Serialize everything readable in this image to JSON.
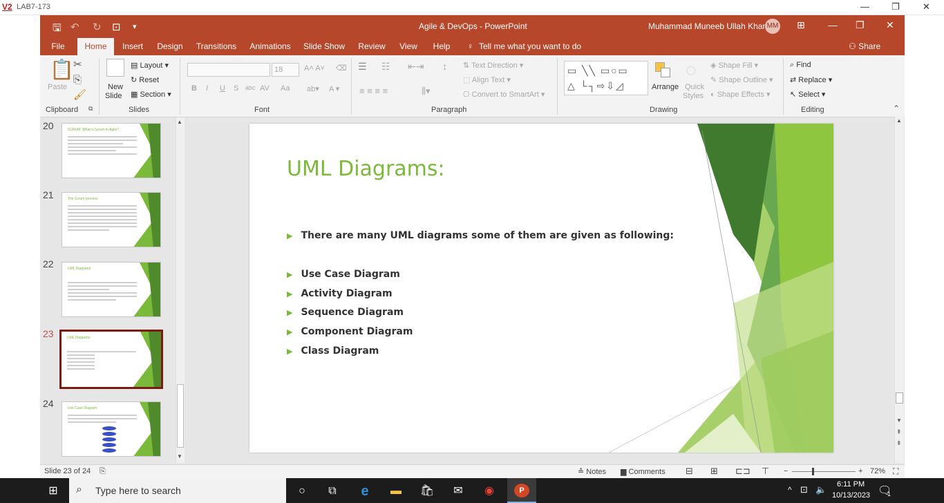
{
  "outer": {
    "logo": "V2",
    "title": "LAB7-173",
    "controls": [
      "—",
      "❐",
      "✕"
    ]
  },
  "titlebar": {
    "doc_title": "Agile & DevOps  -  PowerPoint",
    "user": "Muhammad Muneeb Ullah Khan",
    "avatar": "MM"
  },
  "tabs": [
    "File",
    "Home",
    "Insert",
    "Design",
    "Transitions",
    "Animations",
    "Slide Show",
    "Review",
    "View",
    "Help"
  ],
  "active_tab": "Home",
  "tell_me": "Tell me what you want to do",
  "share": "Share",
  "ribbon": {
    "clipboard": {
      "paste": "Paste",
      "label": "Clipboard"
    },
    "slides": {
      "new_slide": "New",
      "new_slide2": "Slide",
      "layout": "Layout",
      "reset": "Reset",
      "section": "Section",
      "label": "Slides"
    },
    "font": {
      "size": "18",
      "bold": "B",
      "italic": "I",
      "underline": "U",
      "shadow": "S",
      "strike": "abc",
      "spacing": "AV",
      "case": "Aa",
      "label": "Font"
    },
    "paragraph": {
      "text_direction": "Text Direction",
      "align_text": "Align Text",
      "convert": "Convert to SmartArt",
      "label": "Paragraph"
    },
    "drawing": {
      "arrange": "Arrange",
      "quick": "Quick",
      "styles": "Styles",
      "shape_fill": "Shape Fill",
      "shape_outline": "Shape Outline",
      "shape_effects": "Shape Effects",
      "label": "Drawing"
    },
    "editing": {
      "find": "Find",
      "replace": "Replace",
      "select": "Select",
      "label": "Editing"
    }
  },
  "thumbnails": [
    {
      "num": "20",
      "title": "SCRUM: What is Scrum in Agile?"
    },
    {
      "num": "21",
      "title": "The Scrum process"
    },
    {
      "num": "22",
      "title": "UML Diagrams:"
    },
    {
      "num": "23",
      "title": "UML Diagrams:"
    },
    {
      "num": "24",
      "title": "Use Case Diagram"
    }
  ],
  "slide": {
    "title": "UML Diagrams:",
    "intro": "There are many UML diagrams some of them are given as following:",
    "bullets": [
      "Use Case Diagram",
      "Activity Diagram",
      "Sequence Diagram",
      "Component Diagram",
      "Class Diagram"
    ]
  },
  "status": {
    "slide_info": "Slide 23 of 24",
    "notes": "Notes",
    "comments": "Comments",
    "zoom": "72%"
  },
  "taskbar": {
    "search_placeholder": "Type here to search",
    "time": "6:11 PM",
    "date": "10/13/2023",
    "notif_count": "1"
  },
  "colors": {
    "ppt_red": "#b7472a",
    "accent_green": "#7bb93b"
  }
}
